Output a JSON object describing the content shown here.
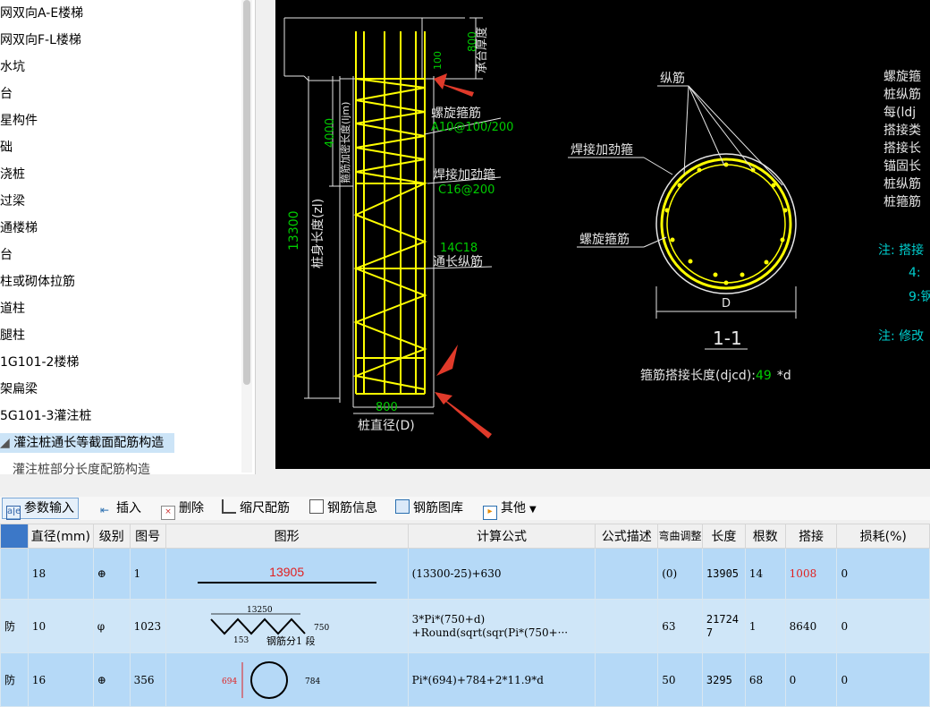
{
  "tree": {
    "items": [
      {
        "label": "网双向A-E楼梯"
      },
      {
        "label": "网双向F-L楼梯"
      },
      {
        "label": "水坑"
      },
      {
        "label": "台"
      },
      {
        "label": "星构件"
      },
      {
        "label": "础"
      },
      {
        "label": "浇桩"
      },
      {
        "label": "过梁"
      },
      {
        "label": "通楼梯"
      },
      {
        "label": "台"
      },
      {
        "label": "柱或砌体拉筋"
      },
      {
        "label": "道柱"
      },
      {
        "label": "腿柱"
      },
      {
        "label": "1G101-2楼梯"
      },
      {
        "label": "架扁梁"
      },
      {
        "label": "5G101-3灌注桩"
      },
      {
        "label": "灌注桩通长等截面配筋构造"
      },
      {
        "label": "灌注桩部分长度配筋构造"
      }
    ]
  },
  "drawing": {
    "dim_800_top": "800",
    "cap_label": "承台厚度",
    "dim_100": "100",
    "dim_4000": "4000",
    "dense_label": "箍筋加密长度(ljm)",
    "dim_13300": "13300",
    "body_label": "桩身长度(zl)",
    "spiral_label": "螺旋箍筋",
    "spiral_spec": "A10@100/200",
    "weld_label": "焊接加劲箍",
    "weld_spec": "C16@200",
    "long_spec": "14C18",
    "long_label": "通长纵筋",
    "dim_800_bottom": "800",
    "dia_label": "桩直径(D)",
    "sec_long_label": "纵筋",
    "sec_weld_label": "焊接加劲箍",
    "sec_spiral_label": "螺旋箍筋",
    "sec_d": "D",
    "sec_title": "1-1",
    "lap_prefix": "箍筋搭接长度(djcd):",
    "lap_value": "49",
    "lap_suffix": "*d",
    "notes": [
      "螺旋箍",
      "桩纵筋",
      "每(ldj",
      "搭接类",
      "搭接长",
      "锚固长",
      "桩纵筋",
      "桩箍筋"
    ],
    "note1": "注: 搭接",
    "note1a": "4:",
    "note1b": "9:钢",
    "note2": "注: 修改"
  },
  "toolbar": {
    "param_input": "参数输入",
    "insert": "插入",
    "delete": "删除",
    "scale": "缩尺配筋",
    "info": "钢筋信息",
    "library": "钢筋图库",
    "other": "其他"
  },
  "table": {
    "headers": [
      "直径(mm)",
      "级别",
      "图号",
      "图形",
      "计算公式",
      "公式描述",
      "弯曲调整",
      "长度",
      "根数",
      "搭接",
      "损耗(%)"
    ],
    "rows": [
      {
        "name": "",
        "dia": "18",
        "grade": "⊕",
        "fig": "1",
        "shape_val": "13905",
        "formula": "(13300-25)+630",
        "desc": "",
        "bend": "(0)",
        "len": "13905",
        "count": "14",
        "lap": "1008",
        "loss": "0"
      },
      {
        "name": "防",
        "dia": "10",
        "grade": "φ",
        "fig": "1023",
        "shape_top": "13250",
        "shape_right": "750",
        "shape_left": "153",
        "shape_note": "钢筋分1 段",
        "formula": "3*Pi*(750+d)",
        "formula2": "+Round(sqrt(sqr(Pi*(750+···",
        "desc": "",
        "bend": "63",
        "len": "21724",
        "len2": "7",
        "count": "1",
        "lap": "8640",
        "loss": "0"
      },
      {
        "name": "防",
        "dia": "16",
        "grade": "⊕",
        "fig": "356",
        "shape_left": "694",
        "shape_right": "784",
        "formula": "Pi*(694)+784+2*11.9*d",
        "desc": "",
        "bend": "50",
        "len": "3295",
        "count": "68",
        "lap": "0",
        "loss": "0"
      }
    ]
  }
}
